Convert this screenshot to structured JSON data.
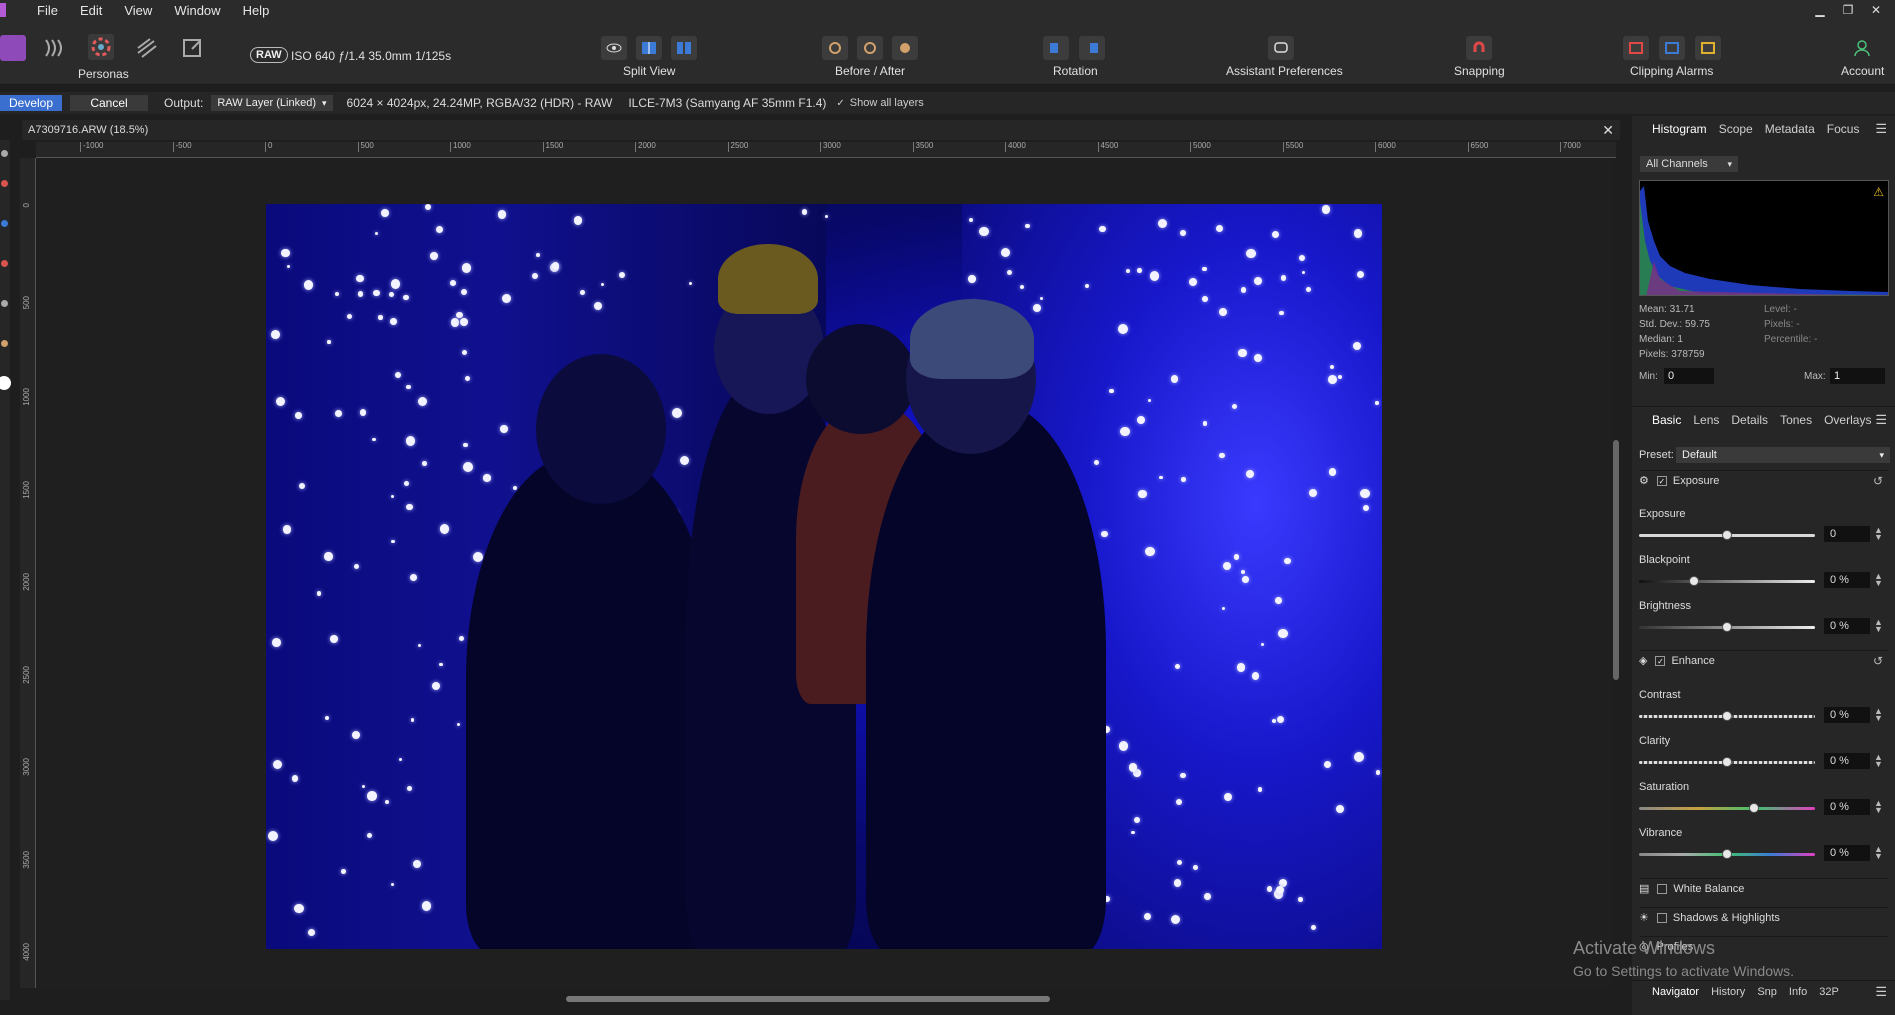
{
  "menubar": {
    "items": [
      "File",
      "Edit",
      "View",
      "Window",
      "Help"
    ]
  },
  "toolbar": {
    "personas_label": "Personas",
    "raw_badge": "RAW",
    "camera_info": "ISO 640 ƒ/1.4 35.0mm 1/125s",
    "split_view": "Split View",
    "before_after": "Before / After",
    "rotation": "Rotation",
    "assistant_preferences": "Assistant Preferences",
    "snapping": "Snapping",
    "clipping_alarms": "Clipping Alarms",
    "account": "Account"
  },
  "context": {
    "develop": "Develop",
    "cancel": "Cancel",
    "output_label": "Output:",
    "output_value": "RAW Layer (Linked)",
    "image_info": "6024 × 4024px, 24.24MP, RGBA/32 (HDR) - RAW",
    "camera": "ILCE-7M3 (Samyang AF 35mm F1.4)",
    "show_all_layers": "Show all layers"
  },
  "document": {
    "title": "A7309716.ARW (18.5%)"
  },
  "ruler": {
    "h": [
      "-1000",
      "-500",
      "0",
      "500",
      "1000",
      "1500",
      "2000",
      "2500",
      "3000",
      "3500",
      "4000",
      "4500",
      "5000",
      "5500",
      "6000",
      "6500",
      "7000"
    ],
    "v": [
      "0",
      "500",
      "1000",
      "1500",
      "2000",
      "2500",
      "3000",
      "3500",
      "4000"
    ]
  },
  "histogram_panel": {
    "tabs": [
      "Histogram",
      "Scope",
      "Metadata",
      "Focus"
    ],
    "channel": "All Channels",
    "mean": "Mean: 31.71",
    "std": "Std. Dev.: 59.75",
    "median": "Median: 1",
    "pixels": "Pixels: 378759",
    "level": "Level: -",
    "pixels_r": "Pixels: -",
    "percentile": "Percentile: -",
    "min_label": "Min:",
    "min_value": "0",
    "max_label": "Max:",
    "max_value": "1"
  },
  "basic_panel": {
    "tabs": [
      "Basic",
      "Lens",
      "Details",
      "Tones",
      "Overlays"
    ],
    "preset_label": "Preset:",
    "preset_value": "Default",
    "exposure_section": "Exposure",
    "enhance_section": "Enhance",
    "white_balance": "White Balance",
    "shadows_highlights": "Shadows & Highlights",
    "profiles": "Profiles",
    "sliders": [
      {
        "label": "Exposure",
        "value": "0"
      },
      {
        "label": "Blackpoint",
        "value": "0 %"
      },
      {
        "label": "Brightness",
        "value": "0 %"
      },
      {
        "label": "Contrast",
        "value": "0 %"
      },
      {
        "label": "Clarity",
        "value": "0 %"
      },
      {
        "label": "Saturation",
        "value": "0 %"
      },
      {
        "label": "Vibrance",
        "value": "0 %"
      }
    ]
  },
  "bottom_tabs": [
    "Navigator",
    "History",
    "Snp",
    "Info",
    "32P"
  ],
  "watermark": {
    "line1": "Activate Windows",
    "line2": "Go to Settings to activate Windows."
  }
}
